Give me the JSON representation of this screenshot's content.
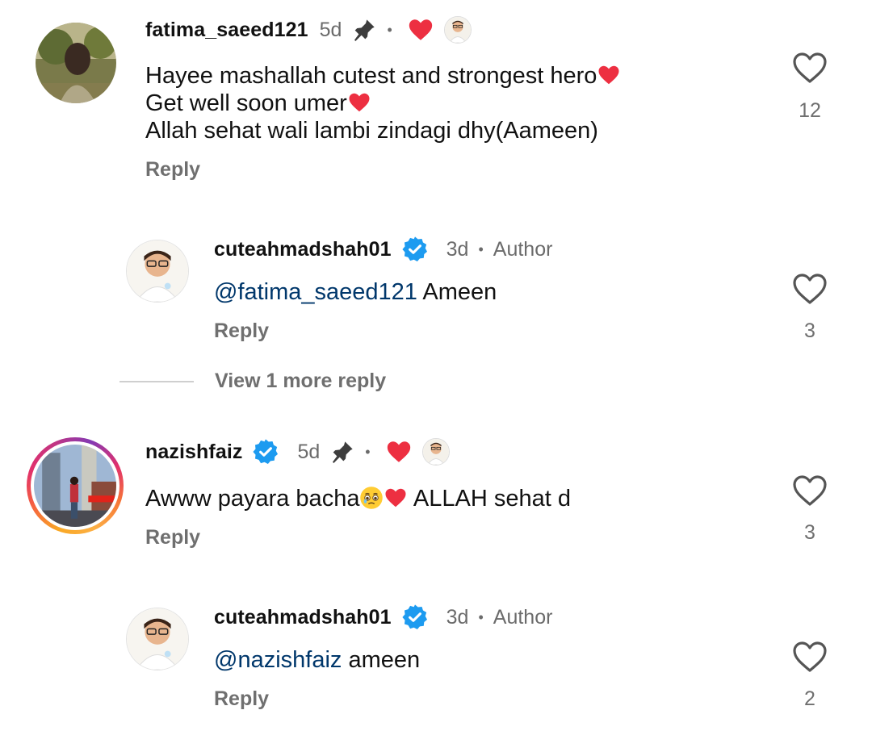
{
  "comments": [
    {
      "username": "fatima_saeed121",
      "time": "5d",
      "lines": [
        "Hayee mashallah cutest and strongest hero",
        "Get well soon umer",
        "Allah sehat wali lambi zindagi dhy(Aameen)"
      ],
      "reply_label": "Reply",
      "like_count": "12"
    },
    {
      "username": "cuteahmadshah01",
      "time": "3d",
      "dot": "•",
      "author_badge": "Author",
      "mention": "@fatima_saeed121",
      "text": " Ameen",
      "reply_label": "Reply",
      "like_count": "3"
    },
    {
      "username": "nazishfaiz",
      "time": "5d",
      "dot": "•",
      "text_start": "Awww payara bacha",
      "text_end": " ALLAH sehat d",
      "reply_label": "Reply",
      "like_count": "3"
    },
    {
      "username": "cuteahmadshah01",
      "time": "3d",
      "dot": "•",
      "author_badge": "Author",
      "mention": "@nazishfaiz",
      "text": " ameen",
      "reply_label": "Reply",
      "like_count": "2"
    }
  ],
  "view_more_replies": "View 1 more reply",
  "dot1": "•",
  "colors": {
    "mention": "#00376b",
    "heart_red": "#ed2f41",
    "verified_blue": "#1d9bf0",
    "muted": "#6f6f6f"
  },
  "icons": [
    "pin-icon",
    "heart-outline-icon",
    "red-heart-icon",
    "verified-badge-icon",
    "crying-face-icon"
  ]
}
